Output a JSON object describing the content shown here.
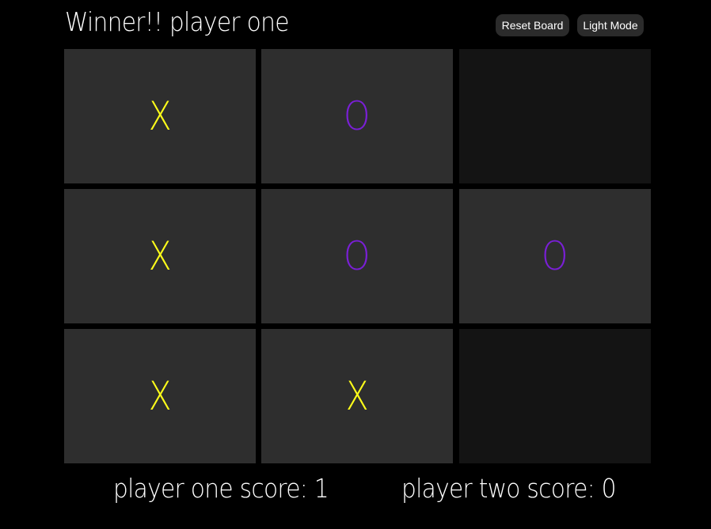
{
  "status": "Winner!! player one",
  "buttons": {
    "reset": "Reset Board",
    "mode": "Light Mode"
  },
  "colors": {
    "x": "#ffff1a",
    "o": "#7a1fd6"
  },
  "board": [
    "X",
    "O",
    "",
    "X",
    "O",
    "O",
    "X",
    "X",
    ""
  ],
  "scores": {
    "one": "player one score: 1",
    "two": "player two score: 0"
  }
}
